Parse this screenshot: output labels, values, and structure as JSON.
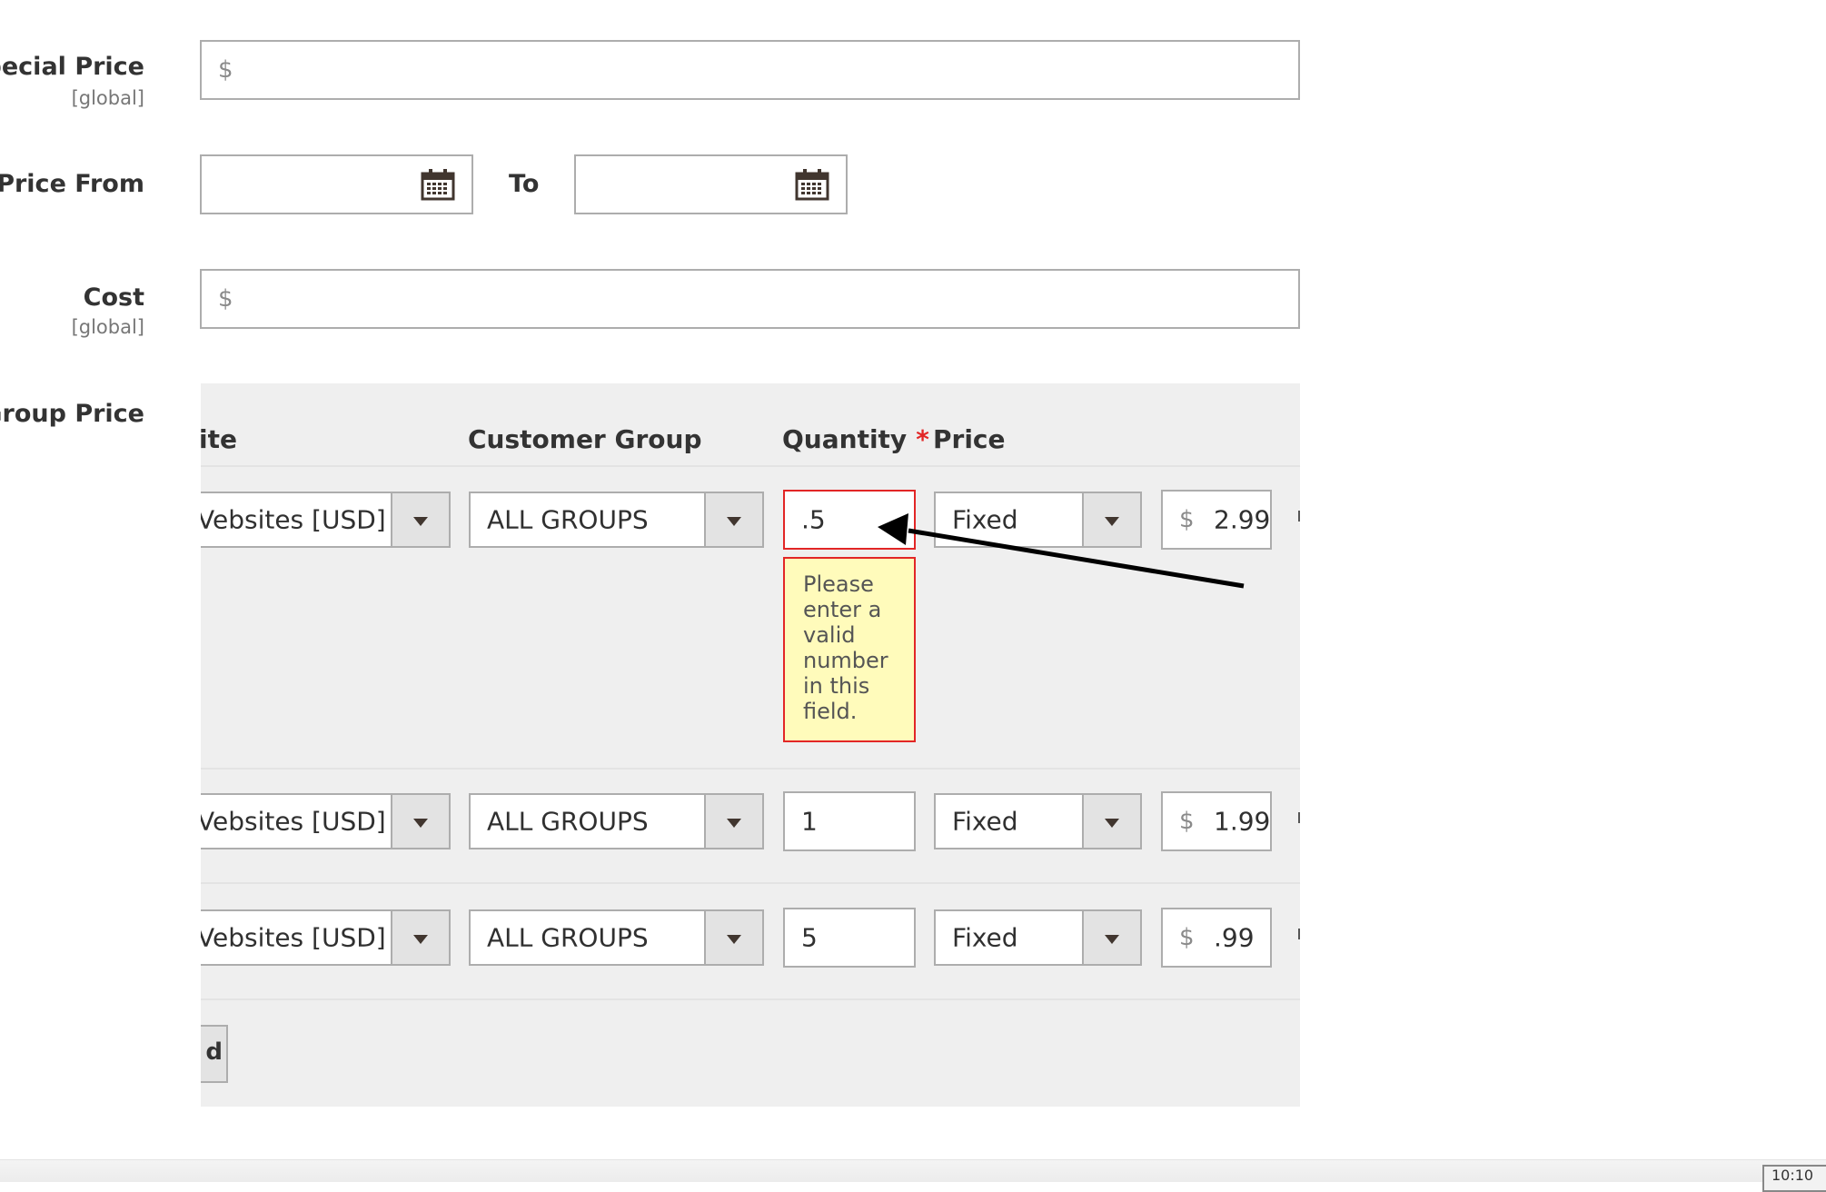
{
  "fields": {
    "special_price": {
      "label": "Special Price",
      "scope": "[global]",
      "currency": "$",
      "value": ""
    },
    "special_price_from": {
      "label": "l Price From",
      "to_label": "To",
      "from_value": "",
      "to_value": ""
    },
    "cost": {
      "label": "Cost",
      "scope": "[global]",
      "currency": "$",
      "value": ""
    }
  },
  "group_price": {
    "label": "Group Price",
    "columns": {
      "website": "ite",
      "customer_group": "Customer Group",
      "quantity": "Quantity",
      "quantity_required": "*",
      "price": "Price"
    },
    "rows": [
      {
        "website": "Vebsites [USD]",
        "customer_group": "ALL GROUPS",
        "quantity": ".5",
        "price_type": "Fixed",
        "currency": "$",
        "price": "2.99",
        "has_error": true
      },
      {
        "website": "Vebsites [USD]",
        "customer_group": "ALL GROUPS",
        "quantity": "1",
        "price_type": "Fixed",
        "currency": "$",
        "price": "1.99",
        "has_error": false
      },
      {
        "website": "Vebsites [USD]",
        "customer_group": "ALL GROUPS",
        "quantity": "5",
        "price_type": "Fixed",
        "currency": "$",
        "price": ".99",
        "has_error": false
      }
    ],
    "error_message": "Please enter a valid number in this field.",
    "add_button_label": "d"
  },
  "clock": {
    "text": "10:10"
  },
  "colors": {
    "label": "#333333",
    "border": "#adadad",
    "error": "#e22626",
    "tooltip_bg": "#fffbbb",
    "panel_bg": "#efefef"
  },
  "icons": [
    "calendar-icon",
    "chevron-down-icon",
    "annotation-arrow"
  ]
}
